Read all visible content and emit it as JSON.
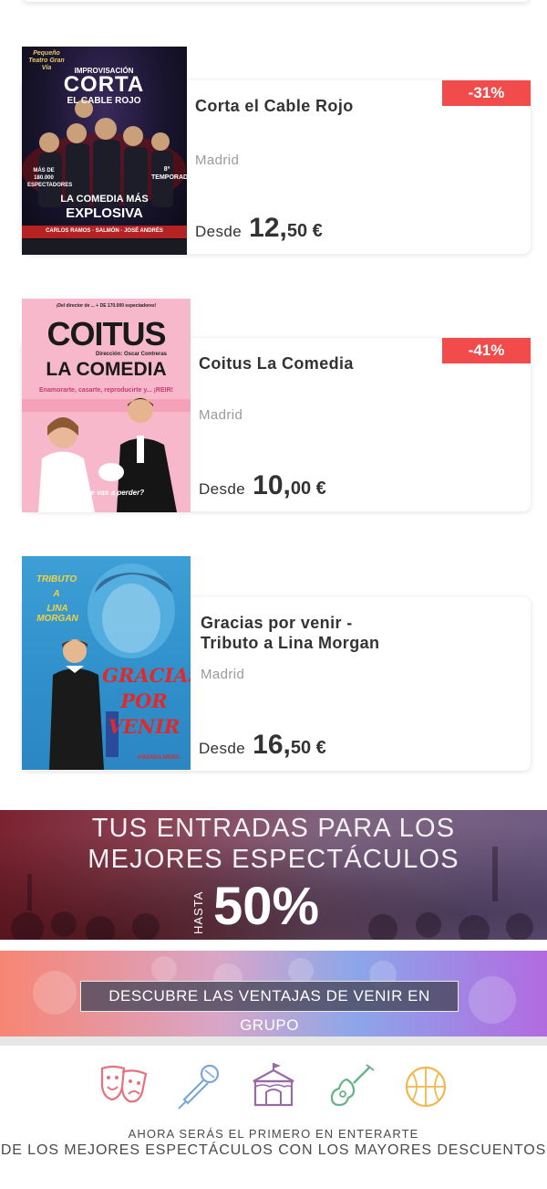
{
  "events": [
    {
      "title": "Corta el Cable Rojo",
      "city": "Madrid",
      "price_from": "Desde",
      "price_int": "12,",
      "price_dec": "50 €",
      "discount": "-31%",
      "poster": {
        "top_left": "Pequeño Teatro Gran Vía",
        "line1": "IMPROVISACIÓN",
        "line2": "CORTA",
        "line3": "EL CABLE ROJO",
        "stat": "MÁS DE 180.000 ESPECTADORES",
        "season": "8ª TEMPORADA",
        "tag1": "LA COMEDIA MÁS",
        "tag2": "EXPLOSIVA",
        "cast": "CARLOS RAMOS · SALMÓN · JOSÉ ANDRÉS"
      }
    },
    {
      "title": "Coitus La Comedia",
      "city": "Madrid",
      "price_from": "Desde",
      "price_int": "10,",
      "price_dec": "00 €",
      "discount": "-41%",
      "poster": {
        "top": "¡Del director de ... + DE 170.000 espectadores!",
        "line1": "COITUS",
        "line2": "LA COMEDIA",
        "director": "Dirección: Oscar Contreras",
        "tagline": "Enamorarte, casarte, reproducirte y... ¡REIR!",
        "question": "¿Tú te vas a perder?"
      }
    },
    {
      "title_line1": "Gracias por venir -",
      "title_line2": "Tributo a Lina Morgan",
      "city": "Madrid",
      "price_from": "Desde",
      "price_int": "16,",
      "price_dec": "50 €",
      "poster": {
        "line1": "TRIBUTO",
        "line2": "A",
        "line3": "LINA MORGAN",
        "title1": "GRACIAS",
        "title2": "POR",
        "title3": "VENIR",
        "actress": "AMANDA MORA"
      }
    }
  ],
  "promo": {
    "line1": "TUS ENTRADAS PARA LOS",
    "line2": "MEJORES ESPECTÁCULOS",
    "hasta": "HASTA",
    "pct": "50%"
  },
  "group_banner": {
    "button": "DESCUBRE LAS VENTAJAS DE VENIR EN GRUPO"
  },
  "categories": [
    {
      "icon": "theater-masks-icon",
      "color": "#e9707e"
    },
    {
      "icon": "microphone-icon",
      "color": "#7aa7d8"
    },
    {
      "icon": "circus-tent-icon",
      "color": "#9a6aa8"
    },
    {
      "icon": "guitar-icon",
      "color": "#66b38a"
    },
    {
      "icon": "basketball-icon",
      "color": "#f0b84f"
    }
  ],
  "footer": {
    "line1": "AHORA SERÁS EL PRIMERO EN ENTERARTE",
    "line2": "DE LOS MEJORES ESPECTÁCULOS CON LOS MAYORES DESCUENTOS"
  },
  "colors": {
    "discount_badge": "#f24b4b",
    "title_text": "#333333",
    "muted_text": "#9a9a9a"
  }
}
